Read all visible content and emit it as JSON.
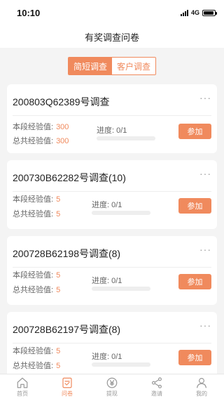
{
  "status": {
    "time": "10:10",
    "network": "4G",
    "battery_level": 0.95
  },
  "header": {
    "title": "有奖调查问卷"
  },
  "segment": {
    "tabs": [
      {
        "label": "简短调查",
        "active": true
      },
      {
        "label": "客户调查",
        "active": false
      }
    ]
  },
  "labels": {
    "stage_exp": "本段经验值:",
    "total_exp": "总共经验值:",
    "progress": "进度:",
    "join": "参加",
    "more": "···"
  },
  "surveys": [
    {
      "title": "200803Q62389号调查",
      "stage_exp": "300",
      "total_exp": "300",
      "progress_text": "0/1",
      "progress": 0
    },
    {
      "title": "200730B62282号调查(10)",
      "stage_exp": "5",
      "total_exp": "5",
      "progress_text": "0/1",
      "progress": 0
    },
    {
      "title": "200728B62198号调查(8)",
      "stage_exp": "5",
      "total_exp": "5",
      "progress_text": "0/1",
      "progress": 0
    },
    {
      "title": "200728B62197号调查(8)",
      "stage_exp": "5",
      "total_exp": "5",
      "progress_text": "0/1",
      "progress": 0
    }
  ],
  "tabbar": {
    "items": [
      {
        "label": "首页",
        "icon": "home-icon",
        "active": false
      },
      {
        "label": "问卷",
        "icon": "questionnaire-icon",
        "active": true
      },
      {
        "label": "提现",
        "icon": "yuan-coin-icon",
        "active": false
      },
      {
        "label": "邀请",
        "icon": "share-icon",
        "active": false
      },
      {
        "label": "我的",
        "icon": "user-icon",
        "active": false
      }
    ]
  },
  "colors": {
    "accent": "#f08a5d",
    "inactive": "#999999",
    "background": "#f4f4f4"
  }
}
